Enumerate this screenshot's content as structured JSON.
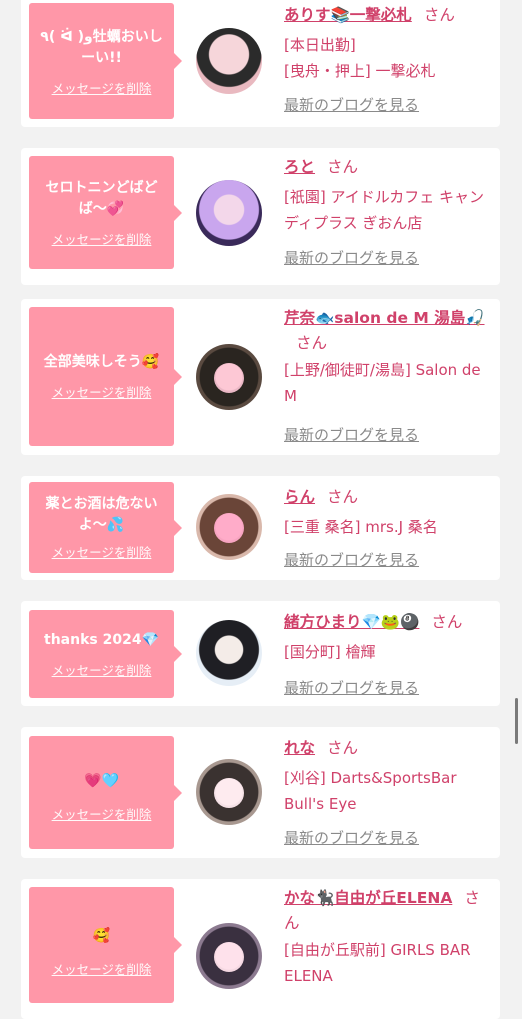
{
  "delete_label": "メッセージを削除",
  "blog_label": "最新のブログを見る",
  "suffix": "さん",
  "colors": {
    "bubble": "#ff97a8",
    "name": "#d0416a",
    "background": "#f2f2f2"
  },
  "entries": [
    {
      "message": "٩( ᐛ )و牡蠣おいしーい!!",
      "name": "ありす📚一撃必札",
      "shop1": "[本日出勤]",
      "shop2": "[曳舟・押上] 一撃必札"
    },
    {
      "message": "セロトニンどばどば〜💞",
      "name": "ろと",
      "shop1": "[祇園] アイドルカフェ キャンディプラス ぎおん店",
      "shop2": ""
    },
    {
      "message": "全部美味しそう🥰",
      "name": "芹奈🐟salon de M 湯島🎣",
      "shop1": "[上野/御徒町/湯島] Salon de M",
      "shop2": ""
    },
    {
      "message": "薬とお酒は危ないよ〜💦",
      "name": "らん",
      "shop1": "[三重 桑名] mrs.J 桑名",
      "shop2": ""
    },
    {
      "message": "thanks 2024💎",
      "name": "緒方ひまり💎🐸🎱",
      "shop1": "[国分町] 檜輝",
      "shop2": ""
    },
    {
      "message": "💗🩵",
      "name": "れな",
      "shop1": "[刈谷] Darts&SportsBar Bull's Eye",
      "shop2": ""
    },
    {
      "message": "🥰",
      "name": "かな🐈‍⬛自由が丘ELENA",
      "shop1": "[自由が丘駅前] GIRLS BAR ELENA",
      "shop2": ""
    }
  ]
}
